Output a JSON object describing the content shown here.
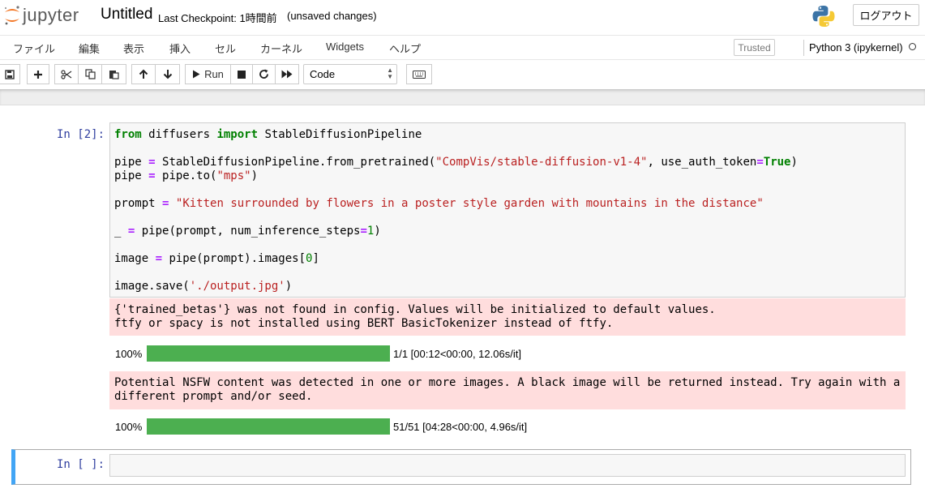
{
  "header": {
    "logo_text": "jupyter",
    "title": "Untitled",
    "checkpoint": "Last Checkpoint: 1時間前",
    "unsaved": "(unsaved changes)",
    "logout_label": "ログアウト"
  },
  "menu": {
    "items": [
      "ファイル",
      "編集",
      "表示",
      "挿入",
      "セル",
      "カーネル",
      "Widgets",
      "ヘルプ"
    ],
    "trusted_label": "Trusted",
    "kernel_name": "Python 3 (ipykernel)"
  },
  "toolbar": {
    "run_label": "Run",
    "cell_type": "Code",
    "icons": [
      "save-icon",
      "plus-icon",
      "cut-icon",
      "copy-icon",
      "paste-icon",
      "arrow-up-icon",
      "arrow-down-icon",
      "play-icon",
      "stop-icon",
      "restart-icon",
      "fast-forward-icon",
      "keyboard-icon"
    ]
  },
  "cells": {
    "code_prompt": "In [2]:",
    "empty_prompt": "In [ ]:",
    "code_lines": [
      "from diffusers import StableDiffusionPipeline",
      "",
      "pipe = StableDiffusionPipeline.from_pretrained(\"CompVis/stable-diffusion-v1-4\", use_auth_token=True)",
      "pipe = pipe.to(\"mps\")",
      "",
      "prompt = \"Kitten surrounded by flowers in a poster style garden with mountains in the distance\"",
      "",
      "_ = pipe(prompt, num_inference_steps=1)",
      "",
      "image = pipe(prompt).images[0]",
      "",
      "image.save('./output.jpg')"
    ],
    "stderr_1": "{'trained_betas'} was not found in config. Values will be initialized to default values.\nftfy or spacy is not installed using BERT BasicTokenizer instead of ftfy.",
    "progress_1": {
      "pct": "100%",
      "fraction": 1.0,
      "stats": "1/1 [00:12<00:00, 12.06s/it]"
    },
    "stderr_2": "Potential NSFW content was detected in one or more images. A black image will be returned instead. Try again with a different prompt and/or seed.",
    "progress_2": {
      "pct": "100%",
      "fraction": 1.0,
      "stats": "51/51 [04:28<00:00, 4.96s/it]"
    }
  },
  "colors": {
    "progress": "#4caf50",
    "stderr_bg": "#ffdddd",
    "prompt": "#303f9f",
    "selected_cell": "#42a5f5"
  }
}
